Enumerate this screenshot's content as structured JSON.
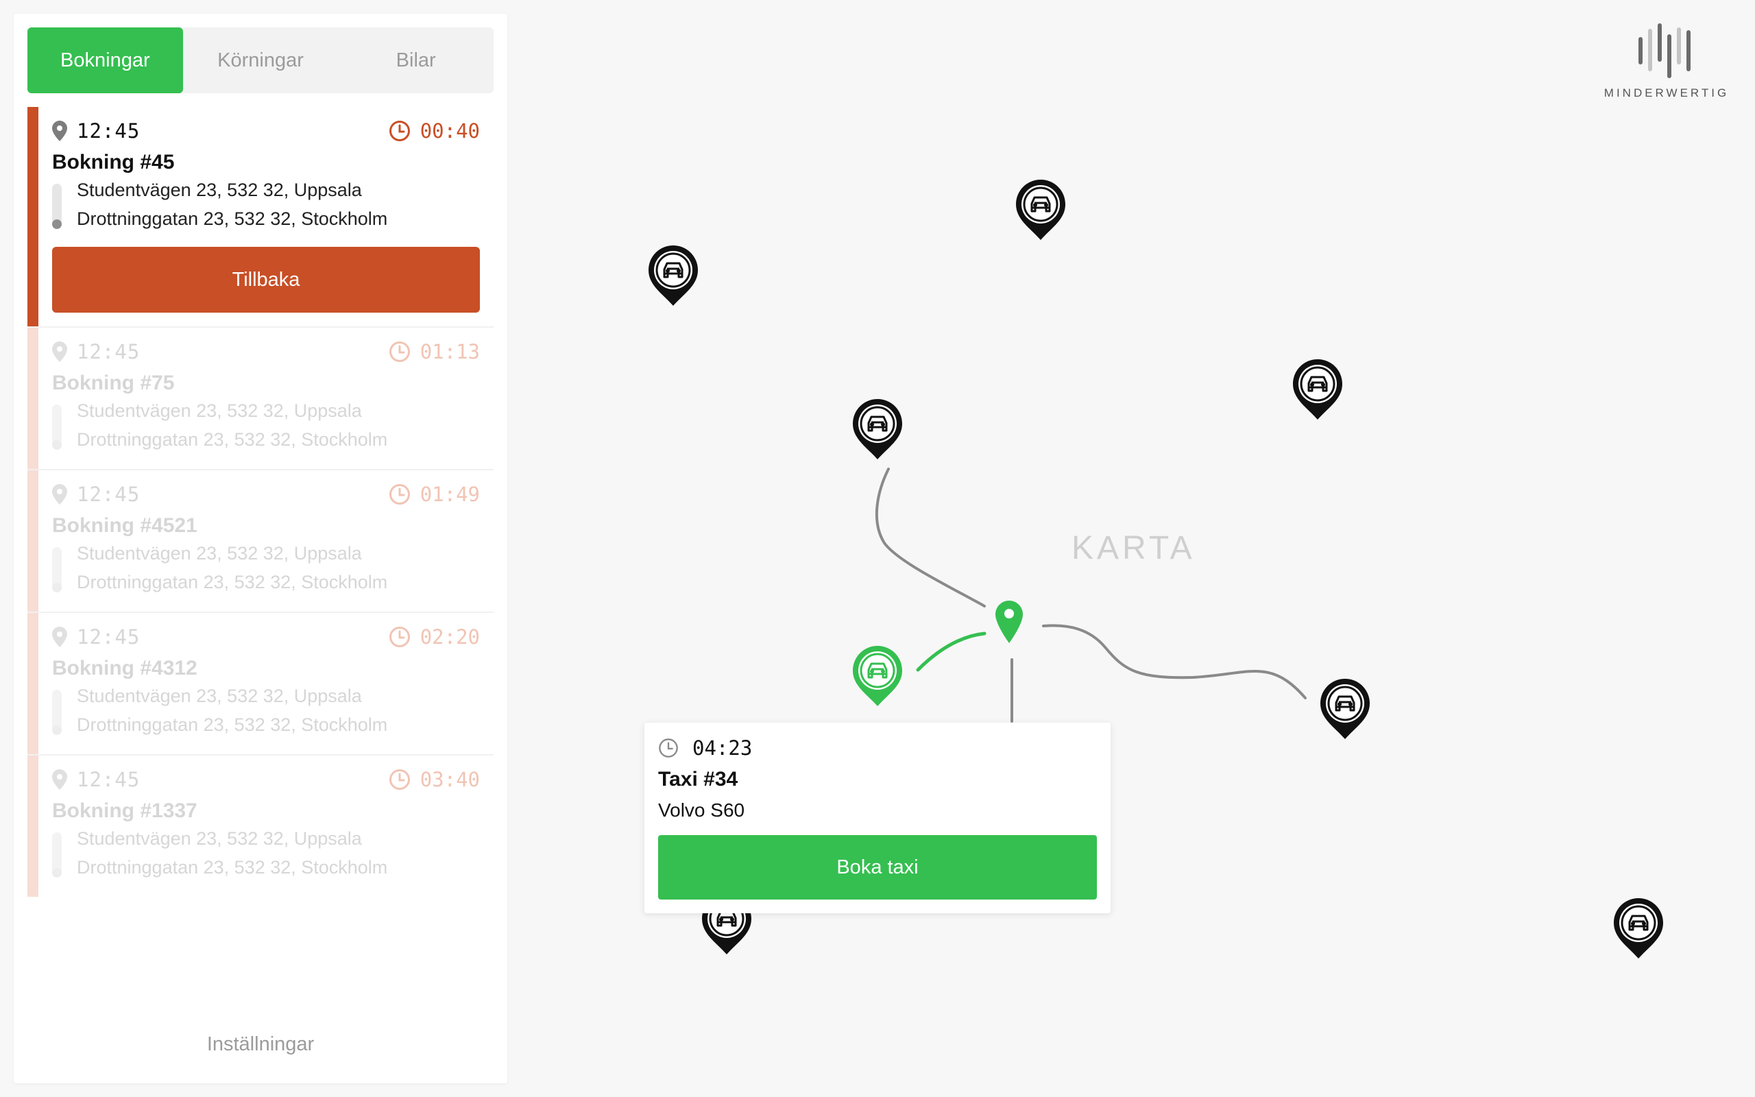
{
  "tabs": [
    {
      "label": "Bokningar",
      "active": true
    },
    {
      "label": "Körningar",
      "active": false
    },
    {
      "label": "Bilar",
      "active": false
    }
  ],
  "bookings": [
    {
      "time": "12:45",
      "timer": "00:40",
      "title": "Bokning #45",
      "from": "Studentvägen 23, 532 32, Uppsala",
      "to": "Drottninggatan 23, 532 32, Stockholm",
      "button": "Tillbaka",
      "active": true
    },
    {
      "time": "12:45",
      "timer": "01:13",
      "title": "Bokning #75",
      "from": "Studentvägen 23, 532 32, Uppsala",
      "to": "Drottninggatan 23, 532 32, Stockholm",
      "active": false
    },
    {
      "time": "12:45",
      "timer": "01:49",
      "title": "Bokning #4521",
      "from": "Studentvägen 23, 532 32, Uppsala",
      "to": "Drottninggatan 23, 532 32, Stockholm",
      "active": false
    },
    {
      "time": "12:45",
      "timer": "02:20",
      "title": "Bokning #4312",
      "from": "Studentvägen 23, 532 32, Uppsala",
      "to": "Drottninggatan 23, 532 32, Stockholm",
      "active": false
    },
    {
      "time": "12:45",
      "timer": "03:40",
      "title": "Bokning #1337",
      "from": "Studentvägen 23, 532 32, Uppsala",
      "to": "Drottninggatan 23, 532 32, Stockholm",
      "active": false
    }
  ],
  "settings_label": "Inställningar",
  "map": {
    "label": "KARTA",
    "logo_text": "MINDERWERTIG",
    "selected_taxi": {
      "eta": "04:23",
      "name": "Taxi #34",
      "model": "Volvo S60",
      "button": "Boka taxi"
    }
  },
  "icons": {
    "location": "map-pin-icon",
    "clock": "clock-icon",
    "car": "car-icon",
    "logo": "minderwertig-logo"
  },
  "colors": {
    "primary_green": "#35bf50",
    "accent_orange": "#c84f26",
    "marker_black": "#111111",
    "route_grey": "#8a8a8a"
  }
}
